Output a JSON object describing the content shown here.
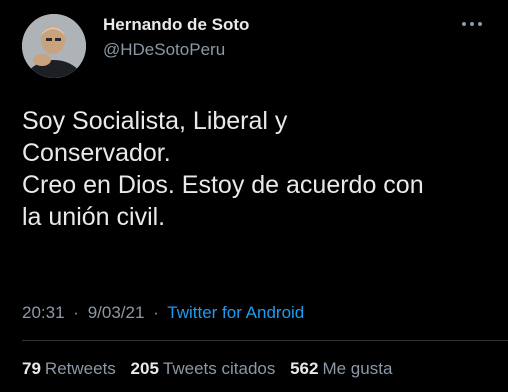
{
  "author": {
    "display_name": "Hernando de Soto",
    "handle": "@HDeSotoPeru",
    "avatar_icon": "profile-photo"
  },
  "tweet": {
    "lines": [
      "Soy Socialista, Liberal y",
      "Conservador.",
      "Creo en Dios. Estoy de acuerdo con",
      "la unión civil."
    ],
    "time": "20:31",
    "separator": "·",
    "date": "9/03/21",
    "source": "Twitter for Android"
  },
  "stats": {
    "retweets": {
      "count": "79",
      "label": "Retweets"
    },
    "quotes": {
      "count": "205",
      "label": "Tweets citados"
    },
    "likes": {
      "count": "562",
      "label": "Me gusta"
    }
  },
  "colors": {
    "background": "#000000",
    "primary_text": "#e7e9ea",
    "secondary_text": "#8b98a5",
    "link": "#1d9bf0",
    "divider": "#2f3336"
  },
  "icons": {
    "more": "more-horizontal-icon"
  }
}
